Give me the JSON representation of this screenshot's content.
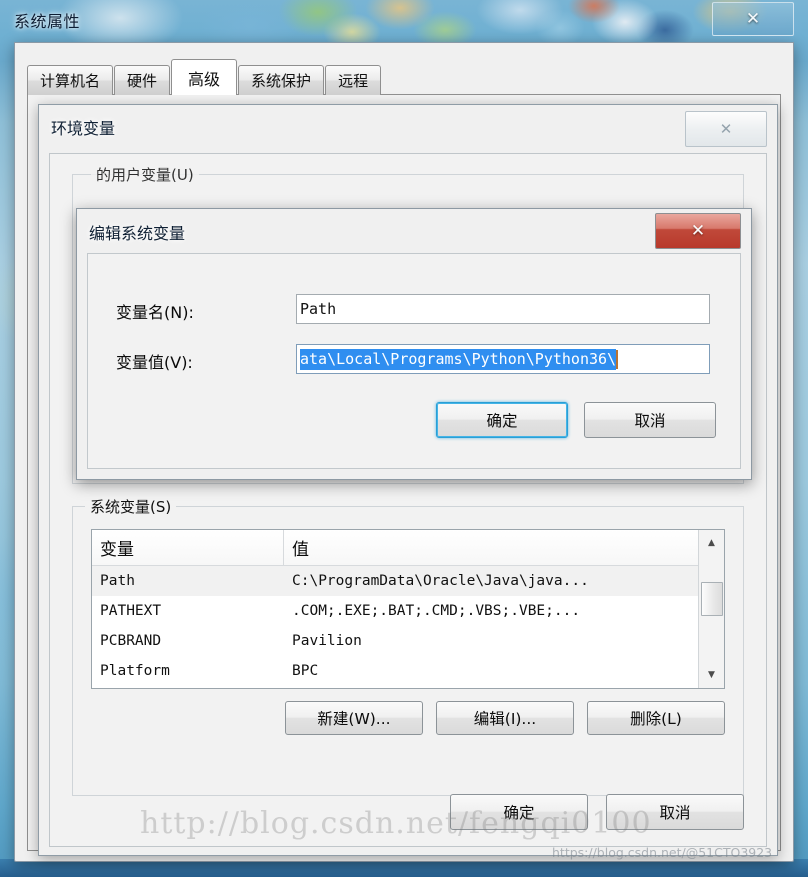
{
  "desktop": {
    "wallpaper_tint": "#7fb8d6"
  },
  "system_properties": {
    "title": "系统属性",
    "close_glyph": "✕",
    "tabs": [
      {
        "label": "计算机名",
        "active": false
      },
      {
        "label": "硬件",
        "active": false
      },
      {
        "label": "高级",
        "active": true
      },
      {
        "label": "系统保护",
        "active": false
      },
      {
        "label": "远程",
        "active": false
      }
    ]
  },
  "environment_variables": {
    "title": "环境变量",
    "close_glyph": "✕",
    "user_section_label": "的用户变量(U)",
    "system_section": {
      "legend": "系统变量(S)",
      "columns": [
        "变量",
        "值"
      ],
      "rows": [
        {
          "name": "Path",
          "value": "C:\\ProgramData\\Oracle\\Java\\java...",
          "selected": true
        },
        {
          "name": "PATHEXT",
          "value": ".COM;.EXE;.BAT;.CMD;.VBS;.VBE;...",
          "selected": false
        },
        {
          "name": "PCBRAND",
          "value": "Pavilion",
          "selected": false
        },
        {
          "name": "Platform",
          "value": "BPC",
          "selected": false
        }
      ],
      "buttons": {
        "new": "新建(W)...",
        "edit": "编辑(I)...",
        "delete": "删除(L)"
      },
      "scrollbar": {
        "up_glyph": "▲",
        "down_glyph": "▼"
      }
    },
    "dialog_buttons": {
      "ok": "确定",
      "cancel": "取消"
    }
  },
  "edit_system_variable": {
    "title": "编辑系统变量",
    "close_glyph": "✕",
    "name_label": "变量名(N):",
    "name_value": "Path",
    "value_label": "变量值(V):",
    "value_selected_text": "ata\\Local\\Programs\\Python\\Python36\\",
    "buttons": {
      "ok": "确定",
      "cancel": "取消"
    }
  },
  "watermarks": {
    "large": "http://blog.csdn.net/fengqi0100",
    "small": "https://blog.csdn.net/@51CTO3923"
  }
}
